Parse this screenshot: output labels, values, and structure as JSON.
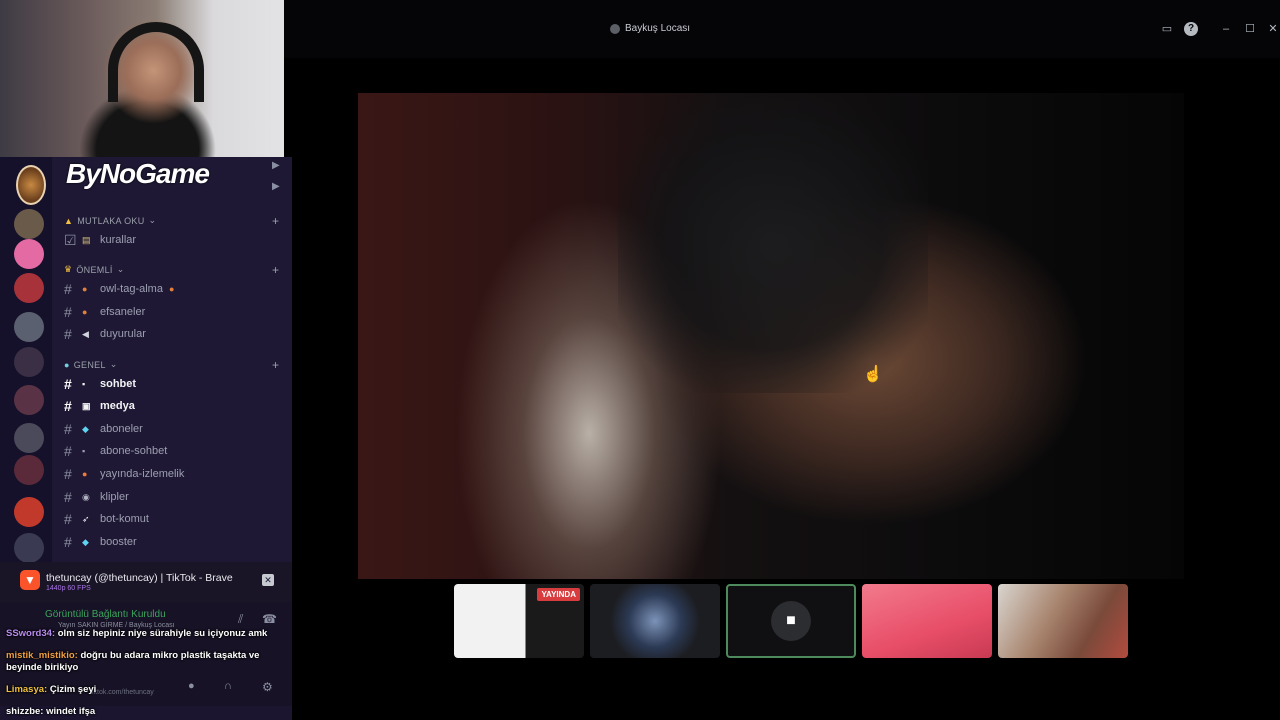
{
  "window": {
    "title": "Baykuş Locası"
  },
  "brand": {
    "logo_text": "ByNoGame"
  },
  "categories": [
    {
      "name": "MUTLAKA OKU",
      "icon": "warning-icon"
    },
    {
      "name": "ÖNEMLİ",
      "icon": "crown-icon"
    },
    {
      "name": "GENEL",
      "icon": "circle-icon"
    }
  ],
  "channels": [
    {
      "label": "kurallar",
      "emoji": "list-icon"
    },
    {
      "label": "owl-tag-alma",
      "emoji": "owl-icon",
      "suffix": "🦉"
    },
    {
      "label": "efsaneler",
      "emoji": "owl-icon"
    },
    {
      "label": "duyurular",
      "emoji": "megaphone-icon"
    },
    {
      "label": "sohbet",
      "emoji": "chat-icon"
    },
    {
      "label": "medya",
      "emoji": "image-icon"
    },
    {
      "label": "aboneler",
      "emoji": "gem-icon"
    },
    {
      "label": "abone-sohbet",
      "emoji": "chat-icon"
    },
    {
      "label": "yayında-izlemelik",
      "emoji": "popcorn-icon"
    },
    {
      "label": "klipler",
      "emoji": "clip-icon"
    },
    {
      "label": "bot-komut",
      "emoji": "rocket-icon"
    },
    {
      "label": "booster",
      "emoji": "gem-icon"
    }
  ],
  "notification": {
    "title": "thetuncay (@thetuncay) | TikTok - Brave",
    "subtitle": "1440p 60 FPS"
  },
  "voice": {
    "status": "Görüntülü Bağlantı Kuruldu",
    "channel": "Yayın SAKIN GİRME / Baykuş Locası",
    "user_url": "tiktok.com/thetuncay"
  },
  "thumbnails": {
    "live_badge": "YAYINDA"
  },
  "chat": [
    {
      "nick": "SSword34:",
      "nick_color": "#b98cf0",
      "msg": "olm siz hepiniz niye sürahiyle su içiyonuz amk"
    },
    {
      "nick": "mistik_mistikio:",
      "nick_color": "#f0a040",
      "msg": "doğru bu adara mikro plastik taşakta ve beyinde birikiyo"
    },
    {
      "nick": "Limasya:",
      "nick_color": "#f0c040",
      "msg": "Çizim şeyi"
    },
    {
      "nick": "shizzbe:",
      "nick_color": "#ffffff",
      "msg": "windet ifşa"
    }
  ]
}
